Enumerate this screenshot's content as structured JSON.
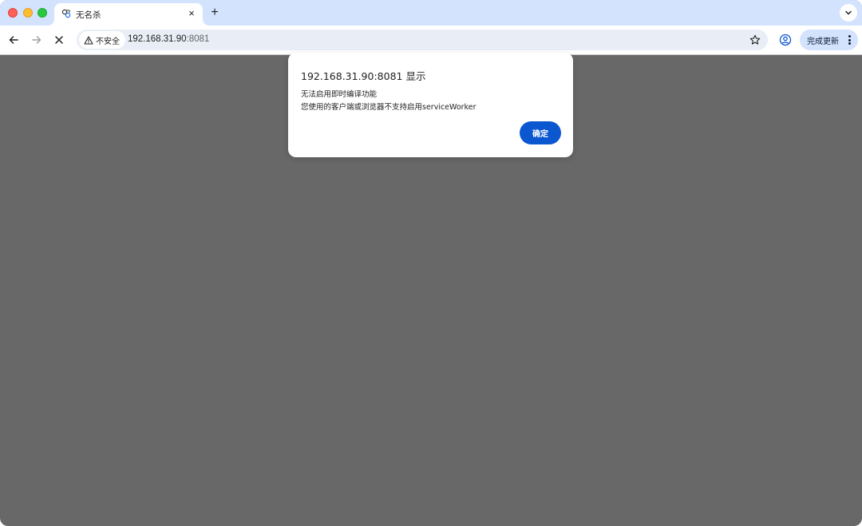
{
  "browser": {
    "tab": {
      "title": "无名杀",
      "favicon": "puzzle-icon",
      "close": "×"
    },
    "new_tab": "+",
    "address_bar": {
      "security_label": "不安全",
      "url_host": "192.168.31.90",
      "url_port": ":8081"
    },
    "update_button_label": "完成更新"
  },
  "dialog": {
    "title": "192.168.31.90:8081 显示",
    "message_line1": "无法启用即时编译功能",
    "message_line2": "您使用的客户端或浏览器不支持启用serviceWorker",
    "ok_label": "确定"
  },
  "colors": {
    "tabstrip": "#d3e3fd",
    "page_background": "#686868",
    "primary_button": "#0b57d0"
  }
}
